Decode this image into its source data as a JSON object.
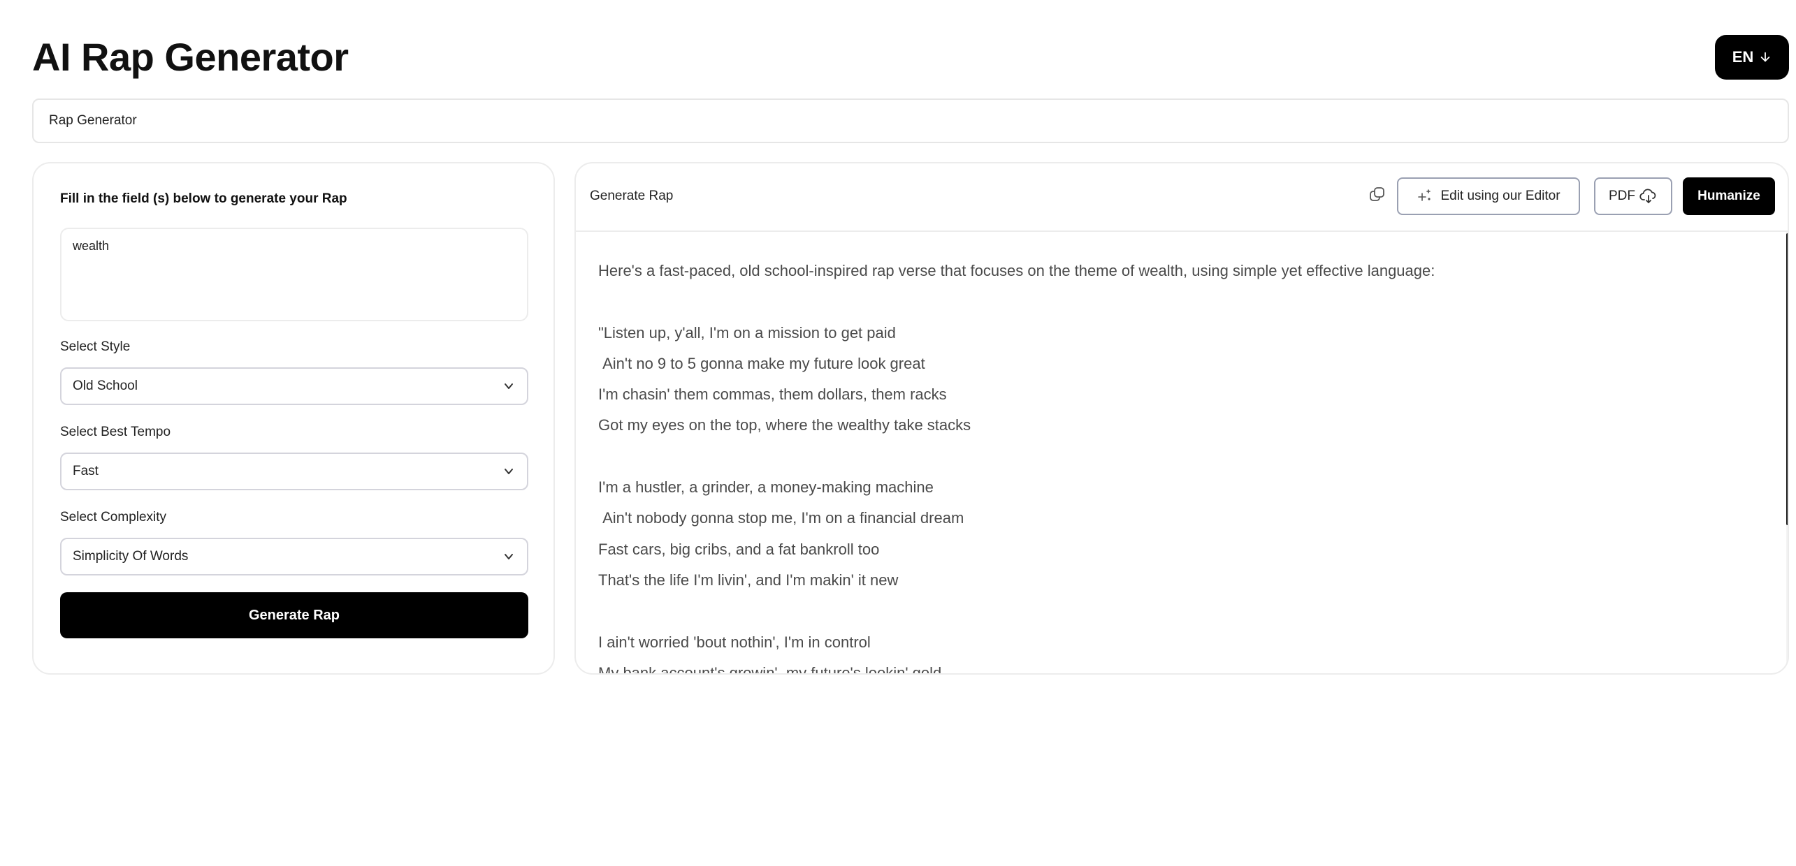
{
  "header": {
    "title": "AI Rap Generator",
    "language_label": "EN"
  },
  "breadcrumb": {
    "label": "Rap Generator"
  },
  "form": {
    "heading": "Fill in the field (s) below to generate your Rap",
    "topic_value": "wealth",
    "style_label": "Select Style",
    "style_value": "Old School",
    "tempo_label": "Select Best Tempo",
    "tempo_value": "Fast",
    "complexity_label": "Select Complexity",
    "complexity_value": "Simplicity Of Words",
    "generate_label": "Generate Rap"
  },
  "output": {
    "title": "Generate Rap",
    "edit_label": "Edit using our Editor",
    "pdf_label": "PDF",
    "humanize_label": "Humanize",
    "text": "Here's a fast-paced, old school-inspired rap verse that focuses on the theme of wealth, using simple yet effective language:\n\n\"Listen up, y'all, I'm on a mission to get paid\n Ain't no 9 to 5 gonna make my future look great\nI'm chasin' them commas, them dollars, them racks\nGot my eyes on the top, where the wealthy take stacks\n\nI'm a hustler, a grinder, a money-making machine\n Ain't nobody gonna stop me, I'm on a financial dream\nFast cars, big cribs, and a fat bankroll too\nThat's the life I'm livin', and I'm makin' it new\n\nI ain't worried 'bout nothin', I'm in control\nMy bank account's growin', my future's lookin' gold"
  },
  "icons": {
    "language": "arrow-down-icon",
    "select": "chevron-down-icon",
    "copy": "copy-icon",
    "edit": "sparkle-icon",
    "pdf": "cloud-download-icon"
  }
}
